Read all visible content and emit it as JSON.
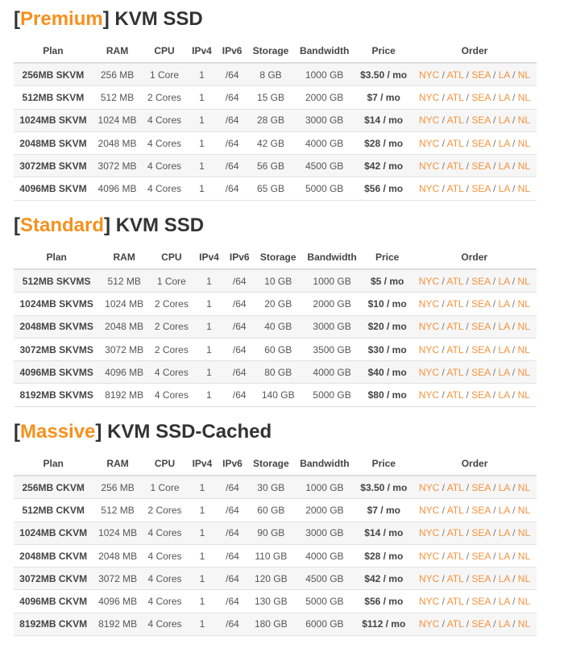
{
  "colors": {
    "accent": "#f7901e",
    "link": "#f7923a",
    "title": "#333333"
  },
  "headers": [
    "Plan",
    "RAM",
    "CPU",
    "IPv4",
    "IPv6",
    "Storage",
    "Bandwidth",
    "Price",
    "Order"
  ],
  "locations": [
    "NYC",
    "ATL",
    "SEA",
    "LA",
    "NL"
  ],
  "sections": [
    {
      "tier": "Premium",
      "title": "KVM SSD",
      "rows": [
        [
          "256MB SKVM",
          "256 MB",
          "1 Core",
          "1",
          "/64",
          "8 GB",
          "1000 GB",
          "$3.50 / mo"
        ],
        [
          "512MB SKVM",
          "512 MB",
          "2 Cores",
          "1",
          "/64",
          "15 GB",
          "2000 GB",
          "$7 / mo"
        ],
        [
          "1024MB SKVM",
          "1024 MB",
          "4 Cores",
          "1",
          "/64",
          "28 GB",
          "3000 GB",
          "$14 / mo"
        ],
        [
          "2048MB SKVM",
          "2048 MB",
          "4 Cores",
          "1",
          "/64",
          "42 GB",
          "4000 GB",
          "$28 / mo"
        ],
        [
          "3072MB SKVM",
          "3072 MB",
          "4 Cores",
          "1",
          "/64",
          "56 GB",
          "4500 GB",
          "$42 / mo"
        ],
        [
          "4096MB SKVM",
          "4096 MB",
          "4 Cores",
          "1",
          "/64",
          "65 GB",
          "5000 GB",
          "$56 / mo"
        ]
      ]
    },
    {
      "tier": "Standard",
      "title": "KVM SSD",
      "rows": [
        [
          "512MB SKVMS",
          "512 MB",
          "1 Core",
          "1",
          "/64",
          "10 GB",
          "1000 GB",
          "$5 / mo"
        ],
        [
          "1024MB SKVMS",
          "1024 MB",
          "2 Cores",
          "1",
          "/64",
          "20 GB",
          "2000 GB",
          "$10 / mo"
        ],
        [
          "2048MB SKVMS",
          "2048 MB",
          "2 Cores",
          "1",
          "/64",
          "40 GB",
          "3000 GB",
          "$20 / mo"
        ],
        [
          "3072MB SKVMS",
          "3072 MB",
          "2 Cores",
          "1",
          "/64",
          "60 GB",
          "3500 GB",
          "$30 / mo"
        ],
        [
          "4096MB SKVMS",
          "4096 MB",
          "4 Cores",
          "1",
          "/64",
          "80 GB",
          "4000 GB",
          "$40 / mo"
        ],
        [
          "8192MB SKVMS",
          "8192 MB",
          "4 Cores",
          "1",
          "/64",
          "140 GB",
          "5000 GB",
          "$80 / mo"
        ]
      ]
    },
    {
      "tier": "Massive",
      "title": "KVM SSD-Cached",
      "rows": [
        [
          "256MB CKVM",
          "256 MB",
          "1 Core",
          "1",
          "/64",
          "30 GB",
          "1000 GB",
          "$3.50 / mo"
        ],
        [
          "512MB CKVM",
          "512 MB",
          "2 Cores",
          "1",
          "/64",
          "60 GB",
          "2000 GB",
          "$7 / mo"
        ],
        [
          "1024MB CKVM",
          "1024 MB",
          "4 Cores",
          "1",
          "/64",
          "90 GB",
          "3000 GB",
          "$14 / mo"
        ],
        [
          "2048MB CKVM",
          "2048 MB",
          "4 Cores",
          "1",
          "/64",
          "110 GB",
          "4000 GB",
          "$28 / mo"
        ],
        [
          "3072MB CKVM",
          "3072 MB",
          "4 Cores",
          "1",
          "/64",
          "120 GB",
          "4500 GB",
          "$42 / mo"
        ],
        [
          "4096MB CKVM",
          "4096 MB",
          "4 Cores",
          "1",
          "/64",
          "130 GB",
          "5000 GB",
          "$56 / mo"
        ],
        [
          "8192MB CKVM",
          "8192 MB",
          "4 Cores",
          "1",
          "/64",
          "180 GB",
          "6000 GB",
          "$112 / mo"
        ]
      ]
    }
  ]
}
